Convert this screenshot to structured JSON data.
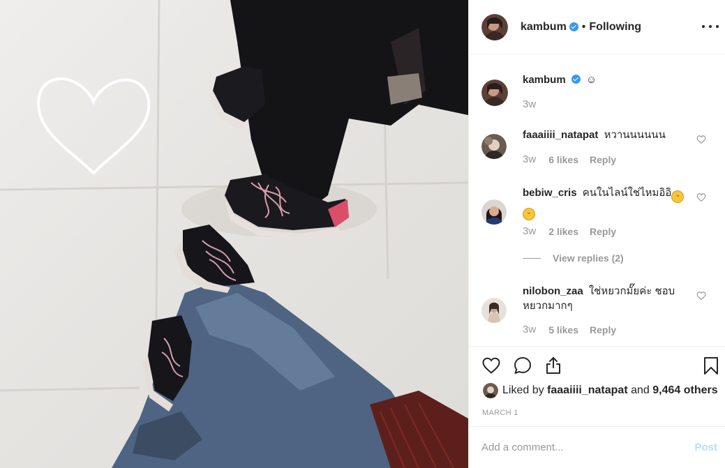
{
  "post": {
    "author": "kambum",
    "separator": "•",
    "follow_status": "Following",
    "caption": "☺",
    "caption_time": "3w"
  },
  "comments": [
    {
      "username": "faaaiiii_natapat",
      "text": "หวานนนนนน",
      "time": "3w",
      "likes": "6 likes",
      "reply_label": "Reply"
    },
    {
      "username": "bebiw_cris",
      "text": "คนในไลน์ใช่ไหมอิอิ",
      "emoji": "😁",
      "time": "3w",
      "likes": "2 likes",
      "reply_label": "Reply",
      "view_replies": "View replies (2)"
    },
    {
      "username": "nilobon_zaa",
      "text": "ใช่หยวกมั๊ยค่ะ ชอบหยวกมากๆ",
      "time": "3w",
      "likes": "5 likes",
      "reply_label": "Reply"
    }
  ],
  "actions": {
    "liked_prefix": "Liked by",
    "liked_user": "faaaiiii_natapat",
    "liked_and": "and",
    "liked_others": "9,464 others",
    "date": "MARCH 1"
  },
  "compose": {
    "placeholder": "Add a comment...",
    "post_label": "Post"
  },
  "icons": {
    "more": "more-options-icon",
    "like": "heart-icon",
    "comment": "comment-icon",
    "share": "share-icon",
    "save": "bookmark-icon",
    "verified": "verified-badge-icon"
  },
  "colors": {
    "verified": "#3897f0",
    "post_disabled": "#b2dffc",
    "meta_gray": "#999999"
  }
}
